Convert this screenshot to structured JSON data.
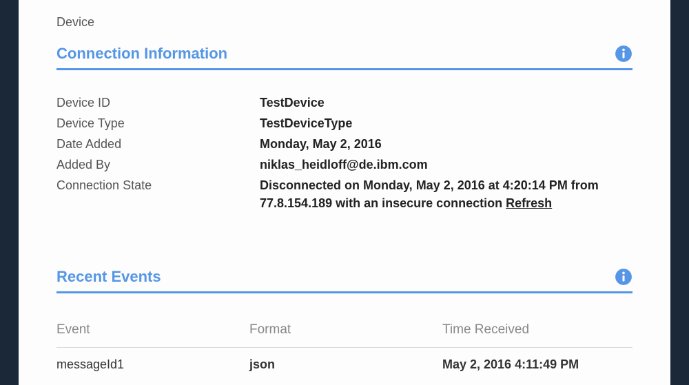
{
  "page": {
    "label": "Device"
  },
  "sections": {
    "connection": {
      "title": "Connection Information",
      "fields": {
        "deviceId": {
          "label": "Device ID",
          "value": "TestDevice"
        },
        "deviceType": {
          "label": "Device Type",
          "value": "TestDeviceType"
        },
        "dateAdded": {
          "label": "Date Added",
          "value": "Monday, May 2, 2016"
        },
        "addedBy": {
          "label": "Added By",
          "value": "niklas_heidloff@de.ibm.com"
        },
        "connState": {
          "label": "Connection State",
          "value": "Disconnected on Monday, May 2, 2016 at 4:20:14 PM from 77.8.154.189 with an insecure connection ",
          "refresh": "Refresh"
        }
      }
    },
    "events": {
      "title": "Recent Events",
      "columns": {
        "event": "Event",
        "format": "Format",
        "time": "Time Received"
      },
      "rows": [
        {
          "event": "messageId1",
          "format": "json",
          "time": "May 2, 2016 4:11:49 PM"
        }
      ]
    }
  }
}
